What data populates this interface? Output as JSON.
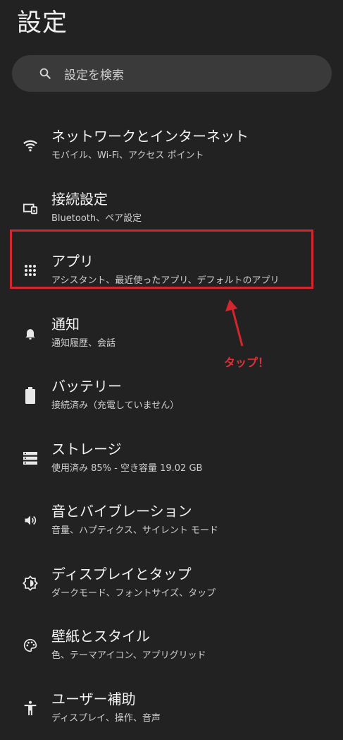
{
  "header": {
    "title": "設定"
  },
  "search": {
    "placeholder": "設定を検索",
    "icon": "search-icon"
  },
  "settings": [
    {
      "label": "ネットワークとインターネット",
      "sub": "モバイル、Wi-Fi、アクセス ポイント",
      "icon": "wifi-icon"
    },
    {
      "label": "接続設定",
      "sub": "Bluetooth、ペア設定",
      "icon": "connected-devices-icon"
    },
    {
      "label": "アプリ",
      "sub": "アシスタント、最近使ったアプリ、デフォルトのアプリ",
      "icon": "apps-grid-icon"
    },
    {
      "label": "通知",
      "sub": "通知履歴、会話",
      "icon": "bell-icon"
    },
    {
      "label": "バッテリー",
      "sub": "接続済み（充電していません）",
      "icon": "battery-icon"
    },
    {
      "label": "ストレージ",
      "sub": "使用済み 85% - 空き容量 19.02 GB",
      "icon": "storage-icon"
    },
    {
      "label": "音とバイブレーション",
      "sub": "音量、ハプティクス、サイレント モード",
      "icon": "volume-icon"
    },
    {
      "label": "ディスプレイとタップ",
      "sub": "ダークモード、フォントサイズ、タップ",
      "icon": "brightness-icon"
    },
    {
      "label": "壁紙とスタイル",
      "sub": "色、テーマアイコン、アプリグリッド",
      "icon": "palette-icon"
    },
    {
      "label": "ユーザー補助",
      "sub": "ディスプレイ、操作、音声",
      "icon": "accessibility-icon"
    }
  ],
  "annotation": {
    "text": "タップ！",
    "color": "#d3262e"
  }
}
